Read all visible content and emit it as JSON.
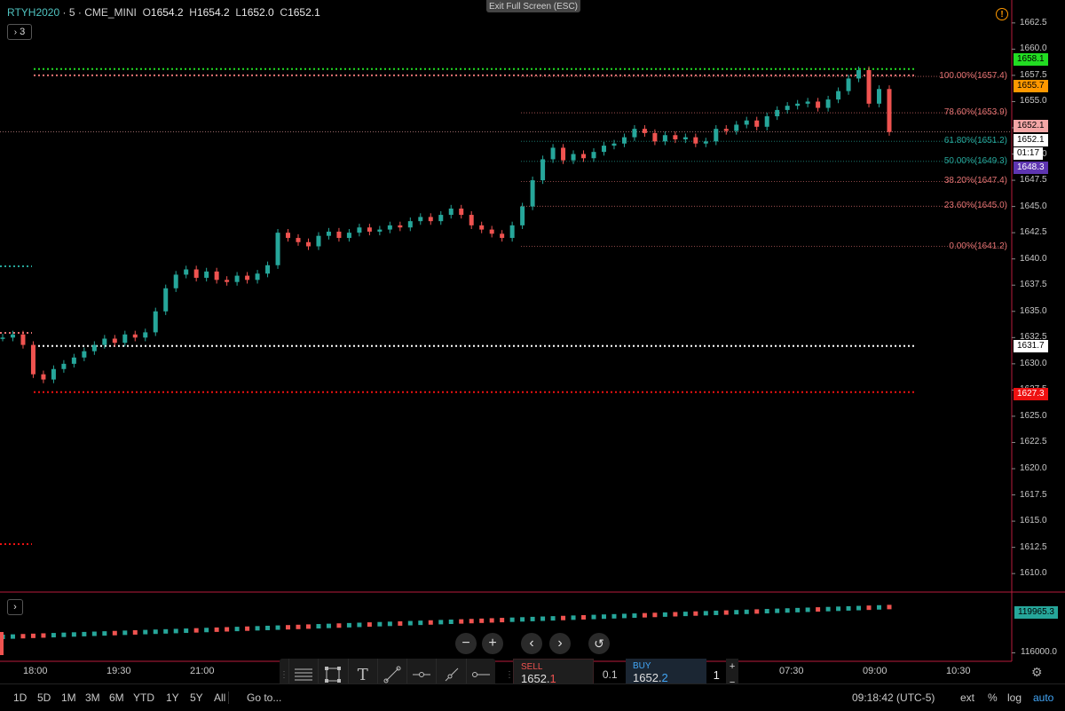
{
  "legend": {
    "symbol": "RTYH2020",
    "sep1": "·",
    "interval": "5",
    "sep2": "·",
    "exchange": "CME_MINI",
    "o_key": "O",
    "o": "1654.2",
    "h_key": "H",
    "h": "1654.2",
    "l_key": "L",
    "l": "1652.0",
    "c_key": "C",
    "c": "1652.1",
    "indicators_toggle": "3"
  },
  "exit_fullscreen": "Exit Full Screen (ESC)",
  "price_axis": {
    "ticks": [
      "1662.5",
      "1660.0",
      "1657.5",
      "1655.0",
      "1652.5",
      "1650.0",
      "1647.5",
      "1645.0",
      "1642.5",
      "1640.0",
      "1637.5",
      "1635.0",
      "1632.5",
      "1630.0",
      "1627.5",
      "1625.0",
      "1622.5",
      "1620.0",
      "1617.5",
      "1615.0",
      "1612.5",
      "1610.0"
    ],
    "tags": [
      {
        "text": "1658.1",
        "bg": "#22dd22",
        "fg": "#000000"
      },
      {
        "text": "1655.7",
        "bg": "#ff9800",
        "fg": "#000000"
      },
      {
        "text": "1652.1",
        "bg": "#f4a6a6",
        "fg": "#000000"
      },
      {
        "text": "1652.1",
        "bg": "#ffffff",
        "fg": "#000000"
      },
      {
        "text": "01:17",
        "bg": "#ffffff",
        "fg": "#000000"
      },
      {
        "text": "1648.3",
        "bg": "#5e35b1",
        "fg": "#ffffff"
      },
      {
        "text": "1631.7",
        "bg": "#ffffff",
        "fg": "#000000"
      },
      {
        "text": "1627.3",
        "bg": "#ee1111",
        "fg": "#ffffff"
      }
    ]
  },
  "fib_levels": [
    {
      "label": "100.00%(1657.4)",
      "color": "#e57373"
    },
    {
      "label": "78.60%(1653.9)",
      "color": "#e57373"
    },
    {
      "label": "61.80%(1651.2)",
      "color": "#26a69a"
    },
    {
      "label": "50.00%(1649.3)",
      "color": "#26a69a"
    },
    {
      "label": "38.20%(1647.4)",
      "color": "#e57373"
    },
    {
      "label": "23.60%(1645.0)",
      "color": "#e57373"
    },
    {
      "label": "0.00%(1641.2)",
      "color": "#e57373"
    }
  ],
  "volume_pane": {
    "toggle": "›",
    "ticks": [
      "116000.0"
    ],
    "tag": {
      "text": "119965.3",
      "bg": "#26a69a",
      "fg": "#000000"
    }
  },
  "time_axis": [
    "18:00",
    "19:30",
    "21:00",
    "07:30",
    "09:00",
    "10:30"
  ],
  "zoom_controls": {
    "minus": "−",
    "plus": "+",
    "back": "‹",
    "forward": "›",
    "reset": "↺"
  },
  "trade": {
    "sell_label": "SELL",
    "sell_price_main": "1652.",
    "sell_price_tail": "1",
    "spread": "0.1",
    "buy_label": "BUY",
    "buy_price_main": "1652.",
    "buy_price_tail": "2",
    "qty": "1",
    "qty_plus": "+",
    "qty_minus": "−"
  },
  "bottom_bar": {
    "timeframes": [
      "1D",
      "5D",
      "1M",
      "3M",
      "6M",
      "YTD",
      "1Y",
      "5Y",
      "All"
    ],
    "goto": "Go to...",
    "clock": "09:18:42 (UTC-5)",
    "ext": "ext",
    "percent": "%",
    "log": "log",
    "auto": "auto"
  },
  "colors": {
    "up": "#26a69a",
    "down": "#ef5350",
    "accent": "#2196f3",
    "axis_border": "#b71c3c"
  },
  "chart_data": {
    "type": "candlestick",
    "symbol": "RTYH2020",
    "interval": "5",
    "ylim": [
      1609,
      1663.5
    ],
    "y_ticks": [
      1610.0,
      1612.5,
      1615.0,
      1617.5,
      1620.0,
      1622.5,
      1625.0,
      1627.5,
      1630.0,
      1632.5,
      1635.0,
      1637.5,
      1640.0,
      1642.5,
      1645.0,
      1647.5,
      1650.0,
      1652.5,
      1655.0,
      1657.5,
      1660.0,
      1662.5
    ],
    "x_ticks": [
      "18:00",
      "19:30",
      "21:00",
      "07:30",
      "09:00",
      "10:30"
    ],
    "close_path": [
      1632.5,
      1632.8,
      1631.8,
      1629.0,
      1628.5,
      1629.5,
      1630.0,
      1630.6,
      1631.2,
      1631.8,
      1632.4,
      1632.0,
      1632.8,
      1632.5,
      1633.0,
      1635.0,
      1637.2,
      1638.5,
      1639.0,
      1638.2,
      1638.8,
      1638.0,
      1637.8,
      1638.4,
      1638.0,
      1638.6,
      1639.4,
      1642.5,
      1642.0,
      1641.6,
      1641.2,
      1642.2,
      1642.6,
      1642.0,
      1642.5,
      1643.0,
      1642.6,
      1642.8,
      1643.2,
      1643.0,
      1643.6,
      1644.0,
      1643.6,
      1644.2,
      1644.8,
      1644.2,
      1643.2,
      1642.8,
      1642.4,
      1642.0,
      1643.2,
      1645.0,
      1647.5,
      1649.5,
      1650.6,
      1649.4,
      1650.0,
      1649.6,
      1650.2,
      1650.8,
      1651.0,
      1651.6,
      1652.4,
      1652.0,
      1651.2,
      1651.8,
      1651.4,
      1651.6,
      1651.0,
      1651.2,
      1652.4,
      1652.2,
      1652.8,
      1653.2,
      1652.6,
      1653.6,
      1654.2,
      1654.6,
      1654.8,
      1655.0,
      1654.4,
      1655.2,
      1656.0,
      1657.2,
      1658.0,
      1654.8,
      1656.2,
      1652.1
    ],
    "fib_retracement": {
      "low": 1641.2,
      "high": 1657.4,
      "levels": [
        1.0,
        0.786,
        0.618,
        0.5,
        0.382,
        0.236,
        0.0
      ]
    },
    "horizontal_lines": [
      {
        "price": 1658.1,
        "color": "#22dd22"
      },
      {
        "price": 1657.5,
        "color": "#e57373"
      },
      {
        "price": 1631.7,
        "color": "#ffffff"
      },
      {
        "price": 1627.3,
        "color": "#ee1111"
      }
    ],
    "last_price": 1652.1
  }
}
